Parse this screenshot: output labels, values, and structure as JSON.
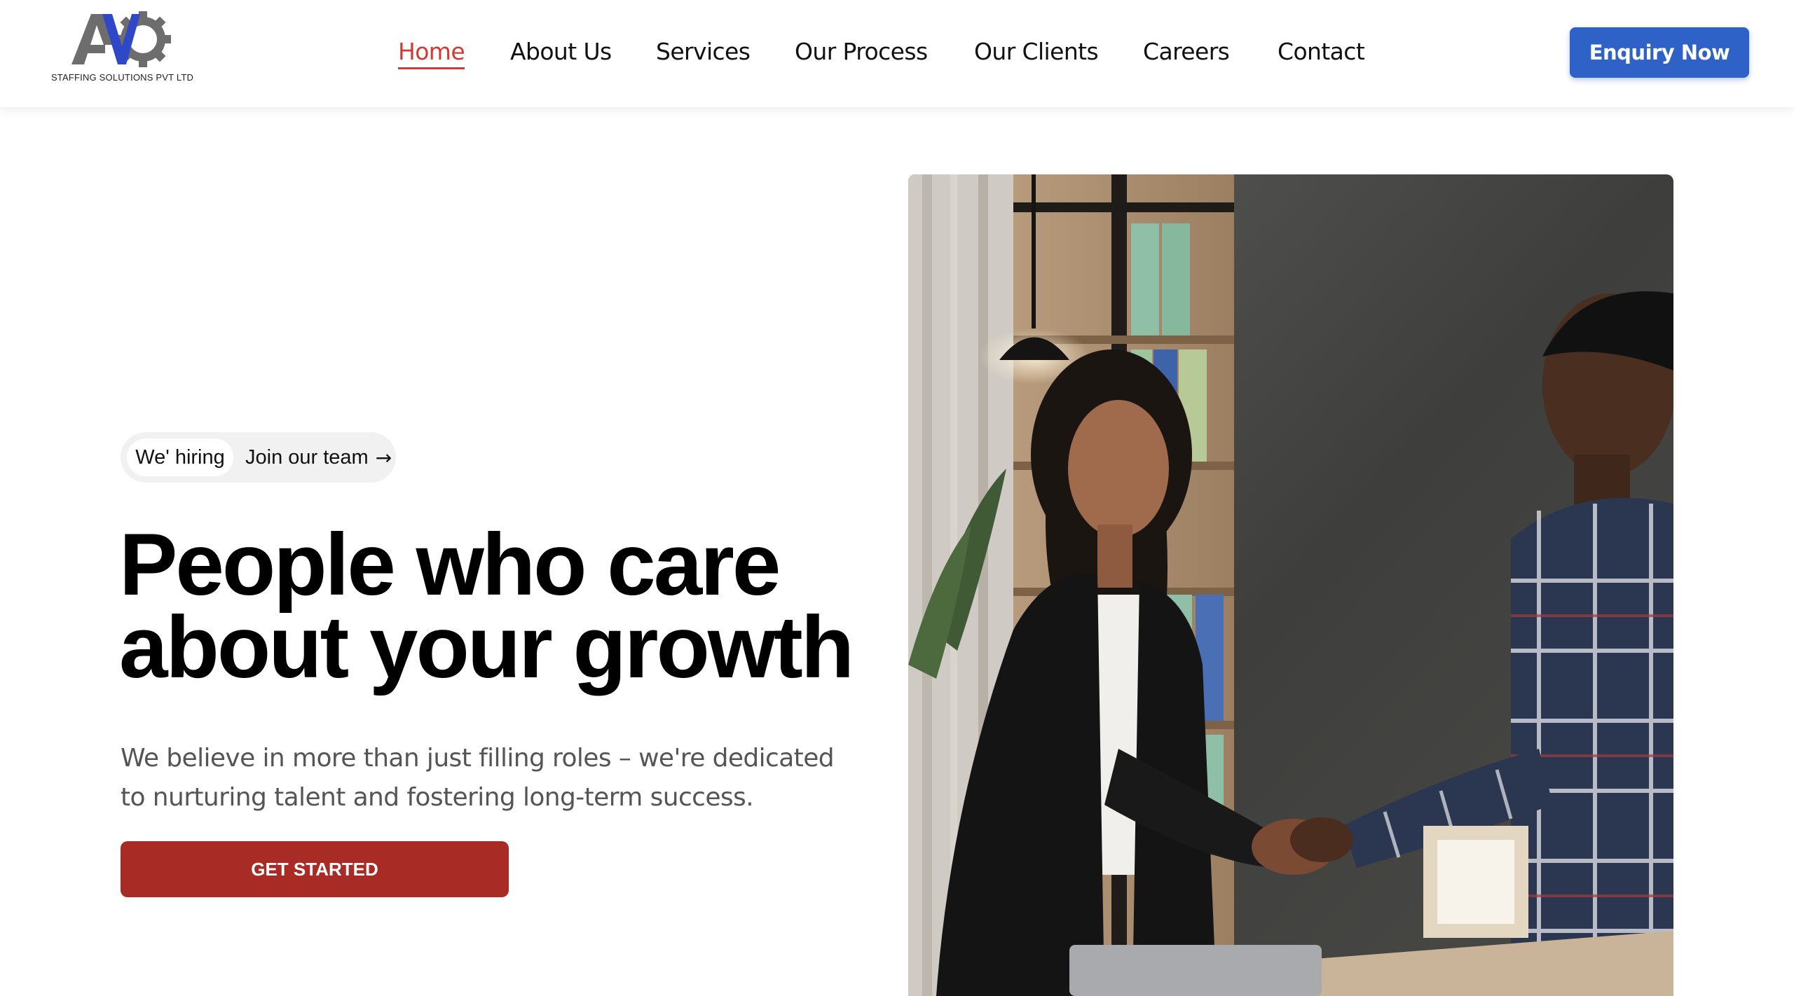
{
  "brand": {
    "logo_text": "AV",
    "tagline": "STAFFING SOLUTIONS PVT LTD",
    "icon": "gear-icon"
  },
  "nav": {
    "items": [
      {
        "label": "Home",
        "active": true
      },
      {
        "label": "About Us",
        "active": false
      },
      {
        "label": "Services",
        "active": false
      },
      {
        "label": "Our Process",
        "active": false
      },
      {
        "label": "Our Clients",
        "active": false
      },
      {
        "label": "Careers",
        "active": false
      },
      {
        "label": "Contact",
        "active": false
      }
    ]
  },
  "header": {
    "enquiry_label": "Enquiry Now"
  },
  "hero": {
    "hiring_tag": "We' hiring",
    "join_label": "Join our team",
    "join_icon": "arrow-right-icon",
    "headline_line1": "People who care",
    "headline_line2": "about your growth",
    "subtext": "We believe in more than just filling roles – we're dedicated to nurturing talent and fostering long-term success.",
    "cta_label": "GET STARTED",
    "image_alt": "Handshake between a recruiter and a candidate in an office"
  },
  "colors": {
    "accent_red": "#d13b34",
    "cta_red": "#a82b26",
    "brand_blue": "#2f62c6",
    "text_dark": "#111111",
    "text_muted": "#555555"
  }
}
